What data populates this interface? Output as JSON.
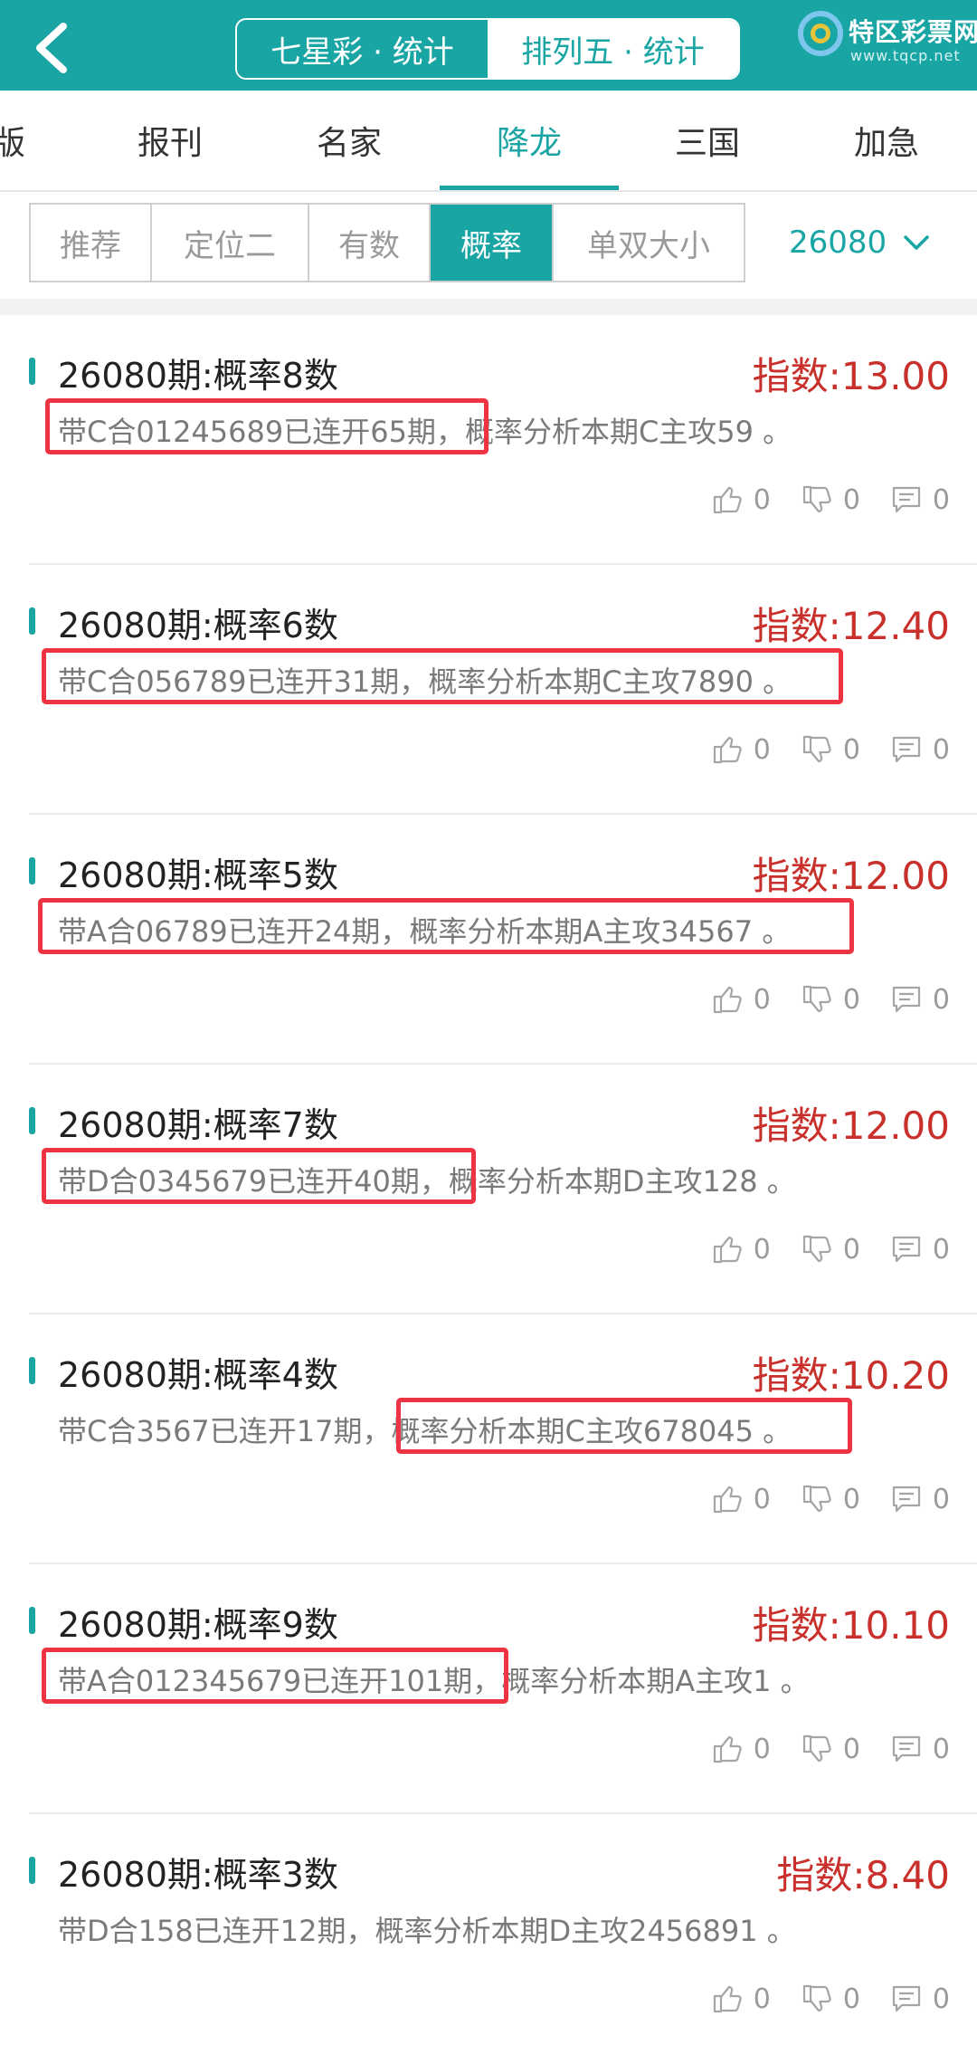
{
  "header": {
    "back_icon": "chevron-left-icon",
    "segments": [
      {
        "label": "七星彩 · 统计",
        "active": true
      },
      {
        "label": "排列五 · 统计",
        "active": false
      }
    ],
    "logo": {
      "name": "特区彩票网",
      "url": "www.tqcp.net"
    }
  },
  "category_tabs": [
    {
      "label": "版",
      "active": false
    },
    {
      "label": "报刊",
      "active": false
    },
    {
      "label": "名家",
      "active": false
    },
    {
      "label": "降龙",
      "active": true
    },
    {
      "label": "三国",
      "active": false
    },
    {
      "label": "加急",
      "active": false
    }
  ],
  "sub_tabs": [
    {
      "label": "推荐",
      "active": false
    },
    {
      "label": "定位二",
      "active": false
    },
    {
      "label": "有数",
      "active": false
    },
    {
      "label": "概率",
      "active": true
    },
    {
      "label": "单双大小",
      "active": false
    }
  ],
  "issue_select": {
    "value": "26080",
    "icon": "chevron-down-icon"
  },
  "colors": {
    "accent": "#1aa5a5",
    "index_red": "#c9302c",
    "highlight_red": "#ee3342"
  },
  "items": [
    {
      "title": "26080期:概率8数",
      "index": "指数:13.00",
      "desc": "带C合01245689已连开65期，概率分析本期C主攻59 。",
      "likes": "0",
      "dislikes": "0",
      "comments": "0"
    },
    {
      "title": "26080期:概率6数",
      "index": "指数:12.40",
      "desc": "带C合056789已连开31期，概率分析本期C主攻7890 。",
      "likes": "0",
      "dislikes": "0",
      "comments": "0"
    },
    {
      "title": "26080期:概率5数",
      "index": "指数:12.00",
      "desc": "带A合06789已连开24期，概率分析本期A主攻34567 。",
      "likes": "0",
      "dislikes": "0",
      "comments": "0"
    },
    {
      "title": "26080期:概率7数",
      "index": "指数:12.00",
      "desc": "带D合0345679已连开40期，概率分析本期D主攻128 。",
      "likes": "0",
      "dislikes": "0",
      "comments": "0"
    },
    {
      "title": "26080期:概率4数",
      "index": "指数:10.20",
      "desc": "带C合3567已连开17期，概率分析本期C主攻678045 。",
      "likes": "0",
      "dislikes": "0",
      "comments": "0"
    },
    {
      "title": "26080期:概率9数",
      "index": "指数:10.10",
      "desc": "带A合012345679已连开101期，概率分析本期A主攻1 。",
      "likes": "0",
      "dislikes": "0",
      "comments": "0"
    },
    {
      "title": "26080期:概率3数",
      "index": "指数:8.40",
      "desc": "带D合158已连开12期，概率分析本期D主攻2456891 。",
      "likes": "0",
      "dislikes": "0",
      "comments": "0"
    }
  ]
}
